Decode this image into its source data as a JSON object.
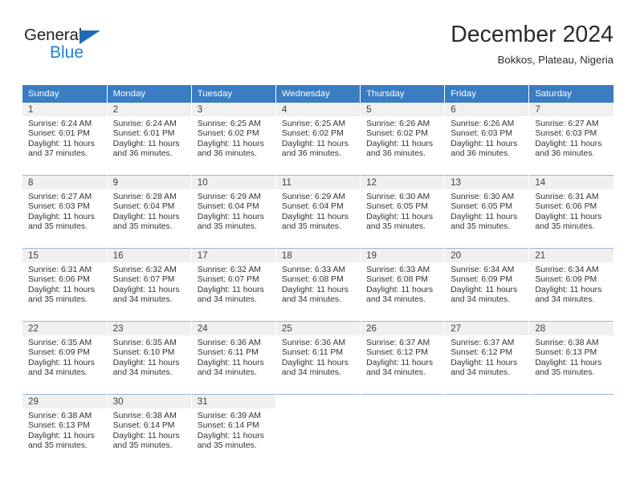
{
  "logo": {
    "word_top": "General",
    "word_bottom": "Blue",
    "triangle_icon": "blue-triangle-icon",
    "color_dark": "#231f20",
    "color_blue": "#1b7fd4"
  },
  "header": {
    "title": "December 2024",
    "subtitle": "Bokkos, Plateau, Nigeria"
  },
  "theme": {
    "header_bg": "#3a7dc2",
    "header_text": "#ffffff",
    "daynum_bg": "#f0f0f0",
    "row_divider": "#9ab6d6",
    "body_text": "#333333"
  },
  "weekday_headers": [
    "Sunday",
    "Monday",
    "Tuesday",
    "Wednesday",
    "Thursday",
    "Friday",
    "Saturday"
  ],
  "weeks": [
    [
      {
        "day": "1",
        "sunrise": "Sunrise: 6:24 AM",
        "sunset": "Sunset: 6:01 PM",
        "daylight1": "Daylight: 11 hours",
        "daylight2": "and 37 minutes."
      },
      {
        "day": "2",
        "sunrise": "Sunrise: 6:24 AM",
        "sunset": "Sunset: 6:01 PM",
        "daylight1": "Daylight: 11 hours",
        "daylight2": "and 36 minutes."
      },
      {
        "day": "3",
        "sunrise": "Sunrise: 6:25 AM",
        "sunset": "Sunset: 6:02 PM",
        "daylight1": "Daylight: 11 hours",
        "daylight2": "and 36 minutes."
      },
      {
        "day": "4",
        "sunrise": "Sunrise: 6:25 AM",
        "sunset": "Sunset: 6:02 PM",
        "daylight1": "Daylight: 11 hours",
        "daylight2": "and 36 minutes."
      },
      {
        "day": "5",
        "sunrise": "Sunrise: 6:26 AM",
        "sunset": "Sunset: 6:02 PM",
        "daylight1": "Daylight: 11 hours",
        "daylight2": "and 36 minutes."
      },
      {
        "day": "6",
        "sunrise": "Sunrise: 6:26 AM",
        "sunset": "Sunset: 6:03 PM",
        "daylight1": "Daylight: 11 hours",
        "daylight2": "and 36 minutes."
      },
      {
        "day": "7",
        "sunrise": "Sunrise: 6:27 AM",
        "sunset": "Sunset: 6:03 PM",
        "daylight1": "Daylight: 11 hours",
        "daylight2": "and 36 minutes."
      }
    ],
    [
      {
        "day": "8",
        "sunrise": "Sunrise: 6:27 AM",
        "sunset": "Sunset: 6:03 PM",
        "daylight1": "Daylight: 11 hours",
        "daylight2": "and 35 minutes."
      },
      {
        "day": "9",
        "sunrise": "Sunrise: 6:28 AM",
        "sunset": "Sunset: 6:04 PM",
        "daylight1": "Daylight: 11 hours",
        "daylight2": "and 35 minutes."
      },
      {
        "day": "10",
        "sunrise": "Sunrise: 6:29 AM",
        "sunset": "Sunset: 6:04 PM",
        "daylight1": "Daylight: 11 hours",
        "daylight2": "and 35 minutes."
      },
      {
        "day": "11",
        "sunrise": "Sunrise: 6:29 AM",
        "sunset": "Sunset: 6:04 PM",
        "daylight1": "Daylight: 11 hours",
        "daylight2": "and 35 minutes."
      },
      {
        "day": "12",
        "sunrise": "Sunrise: 6:30 AM",
        "sunset": "Sunset: 6:05 PM",
        "daylight1": "Daylight: 11 hours",
        "daylight2": "and 35 minutes."
      },
      {
        "day": "13",
        "sunrise": "Sunrise: 6:30 AM",
        "sunset": "Sunset: 6:05 PM",
        "daylight1": "Daylight: 11 hours",
        "daylight2": "and 35 minutes."
      },
      {
        "day": "14",
        "sunrise": "Sunrise: 6:31 AM",
        "sunset": "Sunset: 6:06 PM",
        "daylight1": "Daylight: 11 hours",
        "daylight2": "and 35 minutes."
      }
    ],
    [
      {
        "day": "15",
        "sunrise": "Sunrise: 6:31 AM",
        "sunset": "Sunset: 6:06 PM",
        "daylight1": "Daylight: 11 hours",
        "daylight2": "and 35 minutes."
      },
      {
        "day": "16",
        "sunrise": "Sunrise: 6:32 AM",
        "sunset": "Sunset: 6:07 PM",
        "daylight1": "Daylight: 11 hours",
        "daylight2": "and 34 minutes."
      },
      {
        "day": "17",
        "sunrise": "Sunrise: 6:32 AM",
        "sunset": "Sunset: 6:07 PM",
        "daylight1": "Daylight: 11 hours",
        "daylight2": "and 34 minutes."
      },
      {
        "day": "18",
        "sunrise": "Sunrise: 6:33 AM",
        "sunset": "Sunset: 6:08 PM",
        "daylight1": "Daylight: 11 hours",
        "daylight2": "and 34 minutes."
      },
      {
        "day": "19",
        "sunrise": "Sunrise: 6:33 AM",
        "sunset": "Sunset: 6:08 PM",
        "daylight1": "Daylight: 11 hours",
        "daylight2": "and 34 minutes."
      },
      {
        "day": "20",
        "sunrise": "Sunrise: 6:34 AM",
        "sunset": "Sunset: 6:09 PM",
        "daylight1": "Daylight: 11 hours",
        "daylight2": "and 34 minutes."
      },
      {
        "day": "21",
        "sunrise": "Sunrise: 6:34 AM",
        "sunset": "Sunset: 6:09 PM",
        "daylight1": "Daylight: 11 hours",
        "daylight2": "and 34 minutes."
      }
    ],
    [
      {
        "day": "22",
        "sunrise": "Sunrise: 6:35 AM",
        "sunset": "Sunset: 6:09 PM",
        "daylight1": "Daylight: 11 hours",
        "daylight2": "and 34 minutes."
      },
      {
        "day": "23",
        "sunrise": "Sunrise: 6:35 AM",
        "sunset": "Sunset: 6:10 PM",
        "daylight1": "Daylight: 11 hours",
        "daylight2": "and 34 minutes."
      },
      {
        "day": "24",
        "sunrise": "Sunrise: 6:36 AM",
        "sunset": "Sunset: 6:11 PM",
        "daylight1": "Daylight: 11 hours",
        "daylight2": "and 34 minutes."
      },
      {
        "day": "25",
        "sunrise": "Sunrise: 6:36 AM",
        "sunset": "Sunset: 6:11 PM",
        "daylight1": "Daylight: 11 hours",
        "daylight2": "and 34 minutes."
      },
      {
        "day": "26",
        "sunrise": "Sunrise: 6:37 AM",
        "sunset": "Sunset: 6:12 PM",
        "daylight1": "Daylight: 11 hours",
        "daylight2": "and 34 minutes."
      },
      {
        "day": "27",
        "sunrise": "Sunrise: 6:37 AM",
        "sunset": "Sunset: 6:12 PM",
        "daylight1": "Daylight: 11 hours",
        "daylight2": "and 34 minutes."
      },
      {
        "day": "28",
        "sunrise": "Sunrise: 6:38 AM",
        "sunset": "Sunset: 6:13 PM",
        "daylight1": "Daylight: 11 hours",
        "daylight2": "and 35 minutes."
      }
    ],
    [
      {
        "day": "29",
        "sunrise": "Sunrise: 6:38 AM",
        "sunset": "Sunset: 6:13 PM",
        "daylight1": "Daylight: 11 hours",
        "daylight2": "and 35 minutes."
      },
      {
        "day": "30",
        "sunrise": "Sunrise: 6:38 AM",
        "sunset": "Sunset: 6:14 PM",
        "daylight1": "Daylight: 11 hours",
        "daylight2": "and 35 minutes."
      },
      {
        "day": "31",
        "sunrise": "Sunrise: 6:39 AM",
        "sunset": "Sunset: 6:14 PM",
        "daylight1": "Daylight: 11 hours",
        "daylight2": "and 35 minutes."
      },
      {
        "day": "",
        "sunrise": "",
        "sunset": "",
        "daylight1": "",
        "daylight2": ""
      },
      {
        "day": "",
        "sunrise": "",
        "sunset": "",
        "daylight1": "",
        "daylight2": ""
      },
      {
        "day": "",
        "sunrise": "",
        "sunset": "",
        "daylight1": "",
        "daylight2": ""
      },
      {
        "day": "",
        "sunrise": "",
        "sunset": "",
        "daylight1": "",
        "daylight2": ""
      }
    ]
  ]
}
